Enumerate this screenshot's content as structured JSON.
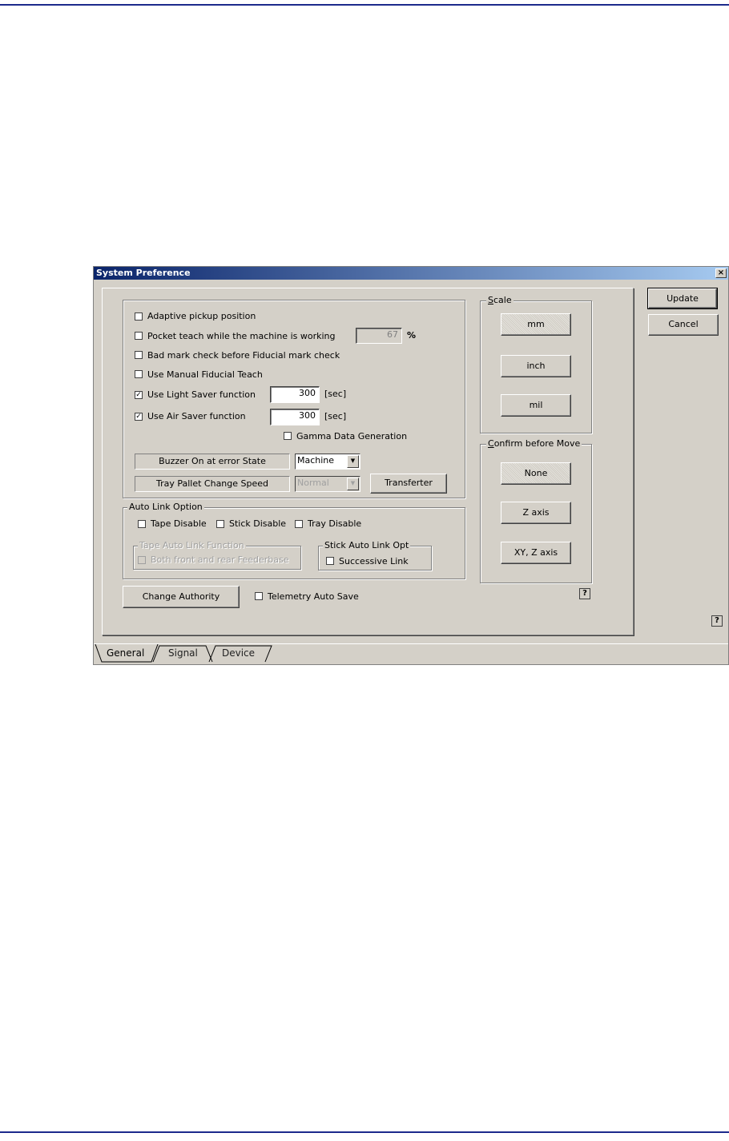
{
  "dialog": {
    "title": "System Preference",
    "close_glyph": "×"
  },
  "options": {
    "adaptive_pickup": {
      "label": "Adaptive pickup position",
      "checked": false
    },
    "pocket_teach": {
      "label": "Pocket teach while the machine is working",
      "checked": false,
      "value": "67",
      "unit": "%"
    },
    "bad_mark": {
      "label": "Bad mark check before Fiducial mark check",
      "checked": false
    },
    "manual_fiducial": {
      "label": "Use Manual Fiducial Teach",
      "checked": false
    },
    "light_saver": {
      "label": "Use Light Saver function",
      "checked": true,
      "value": "300",
      "unit": "[sec]"
    },
    "air_saver": {
      "label": "Use Air Saver function",
      "checked": true,
      "value": "300",
      "unit": "[sec]"
    },
    "gamma": {
      "label": "Gamma Data Generation",
      "checked": false
    }
  },
  "buzzer": {
    "label": "Buzzer On at error State",
    "value": "Machine"
  },
  "tray_pallet": {
    "label": "Tray Pallet Change Speed",
    "value": "Normal",
    "transfer_button": "Transferter"
  },
  "auto_link": {
    "title": "Auto Link Option",
    "tape_disable": "Tape Disable",
    "stick_disable": "Stick Disable",
    "tray_disable": "Tray Disable",
    "tape_function": {
      "title": "Tape Auto Link Function",
      "option": "Both front and rear Feederbase"
    },
    "stick_opt": {
      "title": "Stick Auto Link Opt",
      "option": "Successive Link"
    }
  },
  "change_authority": "Change Authority",
  "telemetry": "Telemetry Auto Save",
  "scale": {
    "title": "Scale",
    "options": [
      "mm",
      "inch",
      "mil"
    ],
    "selected": "mm"
  },
  "confirm": {
    "title": "Confirm before Move",
    "options": [
      "None",
      "Z axis",
      "XY, Z axis"
    ],
    "selected": "None"
  },
  "buttons": {
    "update": "Update",
    "cancel": "Cancel"
  },
  "help_glyph": "?",
  "check_glyph": "✓",
  "combo_arrow": "▼",
  "tabs": [
    "General",
    "Signal",
    "Device"
  ],
  "active_tab": "General"
}
